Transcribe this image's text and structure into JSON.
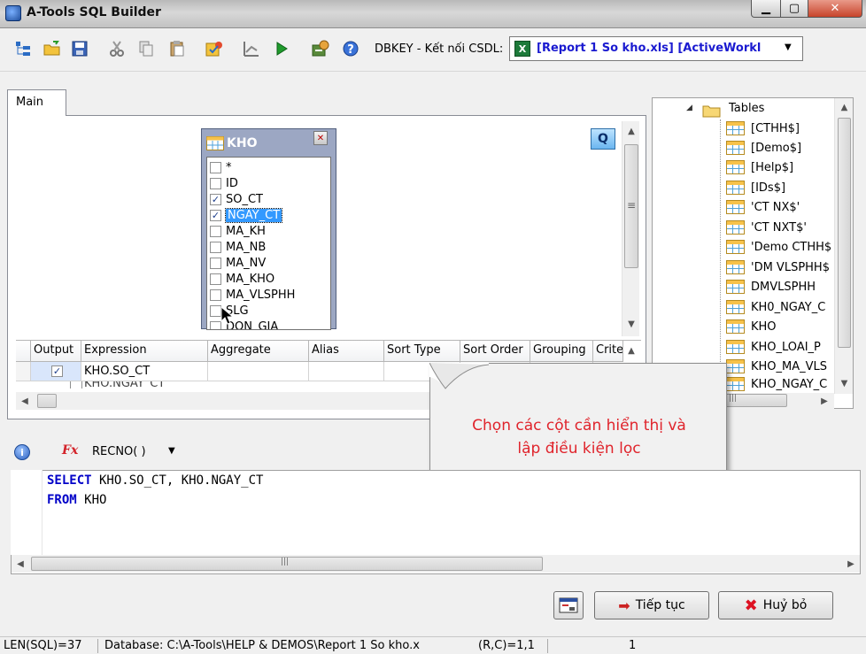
{
  "window": {
    "title": "A-Tools SQL Builder",
    "min_glyph": "▁",
    "max_glyph": "▢",
    "close_glyph": "✕"
  },
  "toolbar": {
    "dbkey_label": "DBKEY - Kết nối CSDL:",
    "db_combo_value": "[Report 1 So kho.xls] [ActiveWorkl",
    "excel_glyph": "X",
    "arrow": "▼"
  },
  "tabs": {
    "main": "Main"
  },
  "kho": {
    "title": "KHO",
    "close_glyph": "✕",
    "fields": [
      {
        "label": "*",
        "checked": false
      },
      {
        "label": "ID",
        "checked": false
      },
      {
        "label": "SO_CT",
        "checked": true
      },
      {
        "label": "NGAY_CT",
        "checked": true
      },
      {
        "label": "MA_KH",
        "checked": false
      },
      {
        "label": "MA_NB",
        "checked": false
      },
      {
        "label": "MA_NV",
        "checked": false
      },
      {
        "label": "MA_KHO",
        "checked": false
      },
      {
        "label": "MA_VLSPHH",
        "checked": false
      },
      {
        "label": "SLG",
        "checked": false
      },
      {
        "label": "DON_GIA",
        "checked": false
      }
    ]
  },
  "zoom_label": "Q",
  "grid": {
    "headers": [
      "Output",
      "Expression",
      "Aggregate",
      "Alias",
      "Sort Type",
      "Sort Order",
      "Grouping",
      "Crite"
    ],
    "row1": {
      "output_check": "✓",
      "expression": "KHO.SO_CT"
    },
    "row2": {
      "expression": "KHO.NGAY_CT"
    }
  },
  "tree": {
    "root": "Tables",
    "collapse_glyph": "◢",
    "items": [
      "[CTHH$]",
      "[Demo$]",
      "[Help$]",
      "[IDs$]",
      "'CT NX$'",
      "'CT NXT$'",
      "'Demo CTHH$",
      "'DM VLSPHH$",
      "DMVLSPHH",
      "KH0_NGAY_C",
      "KHO",
      "KHO_LOAI_P",
      "KHO_MA_VLS",
      "KHO_NGAY_C"
    ]
  },
  "callout": {
    "line1": "Chọn các cột cần hiển thị và",
    "line2": "lập điều kiện lọc"
  },
  "expr_bar": {
    "info_glyph": "i",
    "fx_glyph": "Fx",
    "recno": "RECNO( )",
    "arrow": "▼"
  },
  "sql": {
    "line1_kw": "SELECT",
    "line1_rest": " KHO.SO_CT, KHO.NGAY_CT",
    "line2_kw": "FROM",
    "line2_rest": " KHO"
  },
  "scroll": {
    "up": "▲",
    "down": "▼",
    "left": "◀",
    "right": "▶",
    "grip_v": "≡",
    "grip_h": "|||"
  },
  "buttons": {
    "continue": "Tiếp tục",
    "cancel": "Huỷ bỏ",
    "continue_glyph": "➡",
    "cancel_glyph": "✖"
  },
  "status": {
    "len": "LEN(SQL)=37",
    "database": "Database: C:\\A-Tools\\HELP & DEMOS\\Report 1 So kho.x",
    "rc": "(R,C)=1,1",
    "num": "1"
  }
}
